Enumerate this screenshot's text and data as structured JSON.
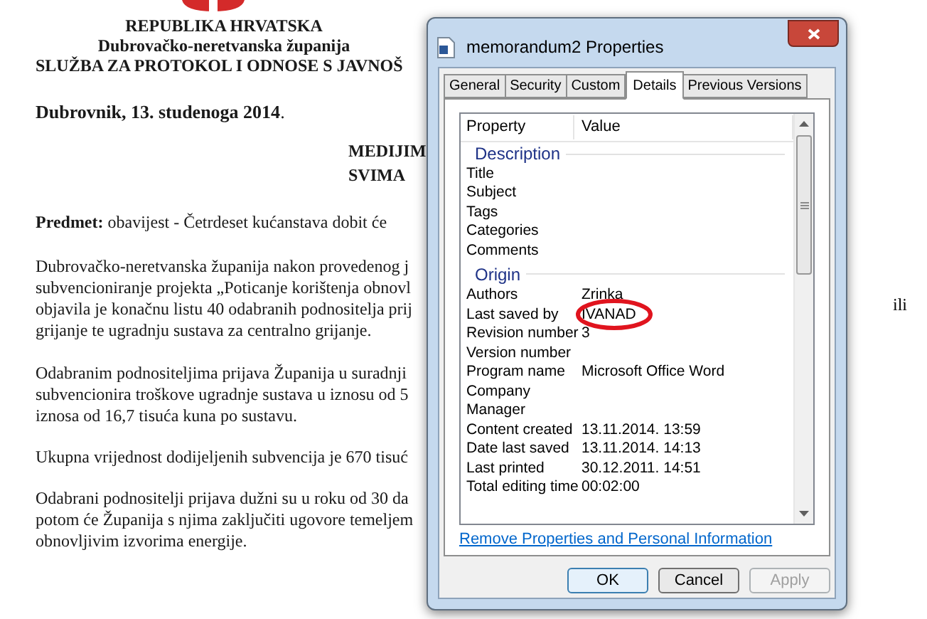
{
  "document": {
    "header": [
      "REPUBLIKA HRVATSKA",
      "Dubrovačko-neretvanska županija",
      "SLUŽBA ZA PROTOKOL I ODNOSE S JAVNOŠ"
    ],
    "date": "**Dubrovnik,  13. studenoga 2014**.",
    "recipients": [
      "MEDIJIM",
      "SVIMA"
    ],
    "subject": "**Predmet:**  obavijest -   Četrdeset kućanstava dobit će",
    "paragraphs": [
      [
        "Dubrovačko-neretvanska županija nakon provedenog j",
        "subvencioniranje projekta „Poticanje korištenja obnovl",
        "objavila je konačnu listu 40 odabranih podnositelja prij",
        "grijanje te ugradnju sustava za centralno grijanje."
      ],
      [
        "Odabranim podnositeljima prijava Županija u suradnji",
        "subvencionira troškove ugradnje sustava u iznosu od 5",
        "iznosa od 16,7 tisuća kuna po sustavu."
      ],
      [
        "Ukupna vrijednost dodijeljenih subvencija je 670 tisuć"
      ],
      [
        "Odabrani podnositelji prijava dužni su u roku od 30 da",
        "potom će Županija s njima zaključiti ugovore temeljem",
        "obnovljivim izvorima energije."
      ]
    ],
    "side_text": "ili"
  },
  "dialog": {
    "title": "memorandum2 Properties",
    "tabs": [
      {
        "label": "General",
        "selected": false
      },
      {
        "label": "Security",
        "selected": false
      },
      {
        "label": "Custom",
        "selected": false
      },
      {
        "label": "Details",
        "selected": true
      },
      {
        "label": "Previous Versions",
        "selected": false
      }
    ],
    "columns": [
      "Property",
      "Value"
    ],
    "sections": [
      {
        "title": "Description",
        "rows": [
          {
            "property": "Title"
          },
          {
            "property": "Subject"
          },
          {
            "property": "Tags"
          },
          {
            "property": "Categories"
          },
          {
            "property": "Comments"
          }
        ]
      },
      {
        "title": "Origin",
        "rows": [
          {
            "property": "Authors",
            "value": "Zrinka"
          },
          {
            "property": "Last saved by",
            "value": "IVANAD",
            "circled": true
          },
          {
            "property": "Revision number",
            "value": "3"
          },
          {
            "property": "Version number"
          },
          {
            "property": "Program name",
            "value": "Microsoft Office Word"
          },
          {
            "property": "Company"
          },
          {
            "property": "Manager"
          },
          {
            "property": "Content created",
            "value": "13.11.2014. 13:59"
          },
          {
            "property": "Date last saved",
            "value": "13.11.2014. 14:13"
          },
          {
            "property": "Last printed",
            "value": "30.12.2011. 14:51"
          },
          {
            "property": "Total editing time",
            "value": "00:02:00"
          }
        ]
      }
    ],
    "link": "Remove Properties and Personal Information",
    "buttons": [
      {
        "label": "OK",
        "kind": "default"
      },
      {
        "label": "Cancel",
        "kind": "normal"
      },
      {
        "label": "Apply",
        "kind": "disabled"
      }
    ]
  }
}
